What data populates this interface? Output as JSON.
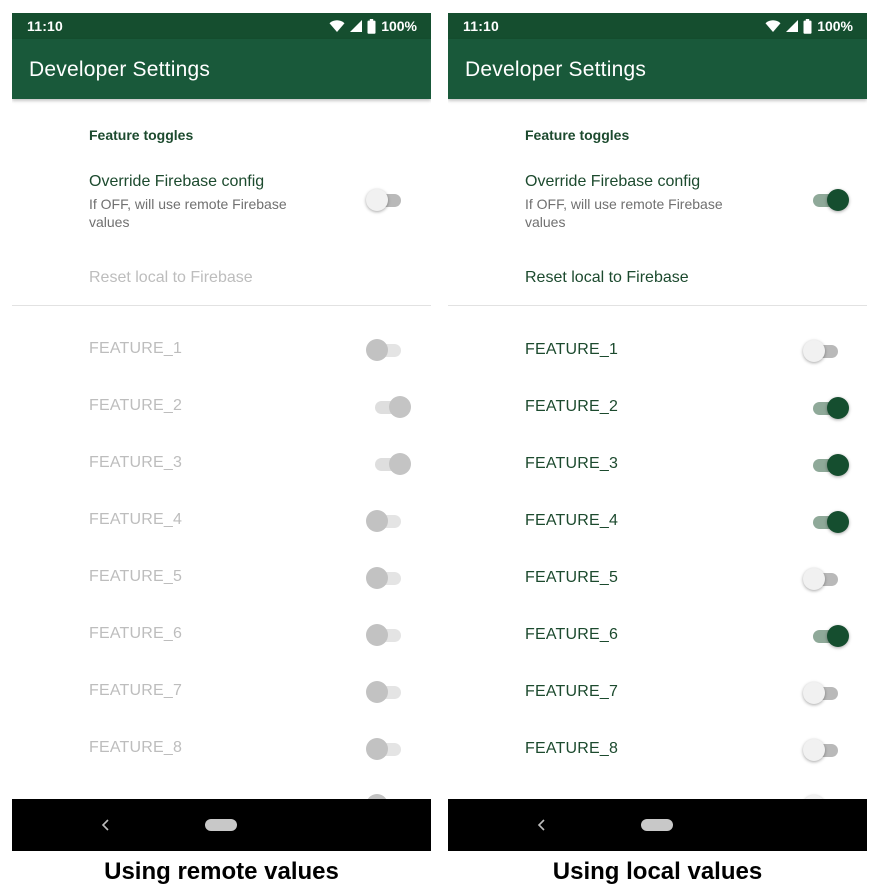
{
  "colors": {
    "status_bar": "#154e2f",
    "app_bar": "#19593a",
    "accent": "#154e2f",
    "text_primary": "#1c4a2e",
    "text_disabled": "#bdbdbd",
    "nav_bar": "#000000"
  },
  "icons": {
    "status": [
      "wifi-icon",
      "cell-signal-icon",
      "battery-icon"
    ],
    "nav": [
      "back-icon",
      "home-pill-icon"
    ]
  },
  "screens": [
    {
      "id": "remote",
      "status_bar": {
        "time": "11:10",
        "battery": "100%"
      },
      "app_bar": {
        "title": "Developer Settings"
      },
      "section_header": "Feature toggles",
      "override": {
        "title": "Override Firebase config",
        "summary": "If OFF, will use remote Firebase values",
        "checked": false
      },
      "reset": {
        "label": "Reset local to Firebase",
        "enabled": false
      },
      "features": [
        {
          "label": "FEATURE_1",
          "checked": false,
          "enabled": false
        },
        {
          "label": "FEATURE_2",
          "checked": true,
          "enabled": false
        },
        {
          "label": "FEATURE_3",
          "checked": true,
          "enabled": false
        },
        {
          "label": "FEATURE_4",
          "checked": false,
          "enabled": false
        },
        {
          "label": "FEATURE_5",
          "checked": false,
          "enabled": false
        },
        {
          "label": "FEATURE_6",
          "checked": false,
          "enabled": false
        },
        {
          "label": "FEATURE_7",
          "checked": false,
          "enabled": false
        },
        {
          "label": "FEATURE_8",
          "checked": false,
          "enabled": false
        }
      ]
    },
    {
      "id": "local",
      "status_bar": {
        "time": "11:10",
        "battery": "100%"
      },
      "app_bar": {
        "title": "Developer Settings"
      },
      "section_header": "Feature toggles",
      "override": {
        "title": "Override Firebase config",
        "summary": "If OFF, will use remote Firebase values",
        "checked": true
      },
      "reset": {
        "label": "Reset local to Firebase",
        "enabled": true
      },
      "features": [
        {
          "label": "FEATURE_1",
          "checked": false,
          "enabled": true
        },
        {
          "label": "FEATURE_2",
          "checked": true,
          "enabled": true
        },
        {
          "label": "FEATURE_3",
          "checked": true,
          "enabled": true
        },
        {
          "label": "FEATURE_4",
          "checked": true,
          "enabled": true
        },
        {
          "label": "FEATURE_5",
          "checked": false,
          "enabled": true
        },
        {
          "label": "FEATURE_6",
          "checked": true,
          "enabled": true
        },
        {
          "label": "FEATURE_7",
          "checked": false,
          "enabled": true
        },
        {
          "label": "FEATURE_8",
          "checked": false,
          "enabled": true
        }
      ]
    }
  ],
  "captions": [
    "Using remote values",
    "Using local values"
  ]
}
